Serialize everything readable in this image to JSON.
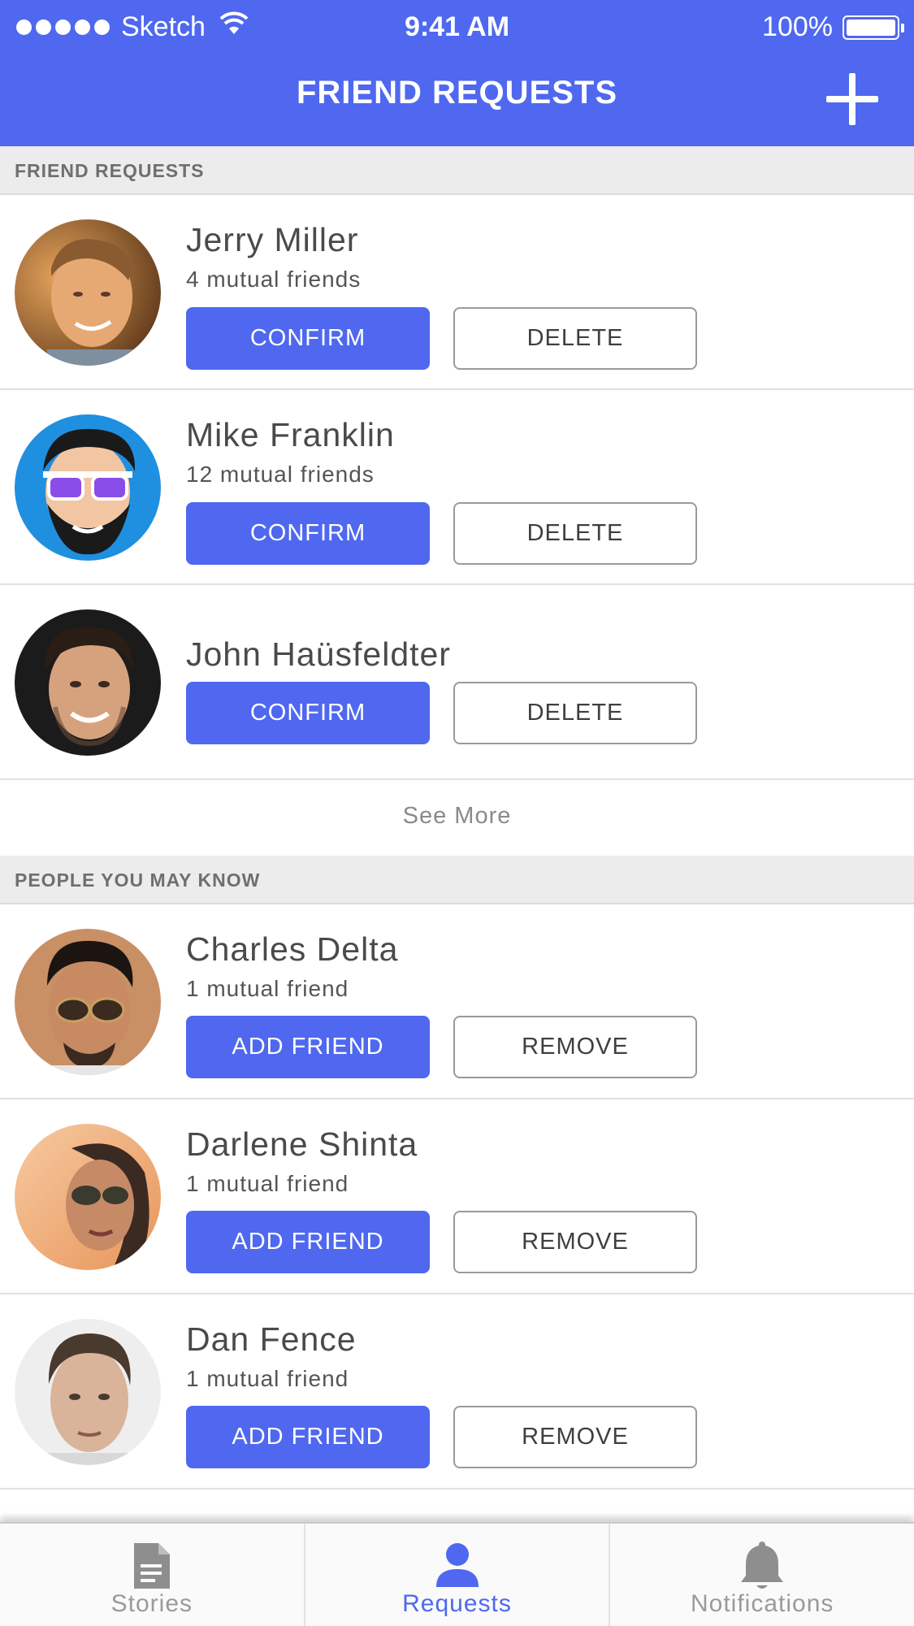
{
  "status_bar": {
    "carrier": "Sketch",
    "time": "9:41 AM",
    "battery": "100%"
  },
  "nav": {
    "title": "FRIEND REQUESTS"
  },
  "friend_requests": {
    "section_title": "FRIEND REQUESTS",
    "items": [
      {
        "name": "Jerry Miller",
        "mutual": "4 mutual friends",
        "confirm_label": "CONFIRM",
        "delete_label": "DELETE"
      },
      {
        "name": "Mike Franklin",
        "mutual": "12 mutual friends",
        "confirm_label": "CONFIRM",
        "delete_label": "DELETE"
      },
      {
        "name": "John Haüsfeldter",
        "mutual": "",
        "confirm_label": "CONFIRM",
        "delete_label": "DELETE"
      }
    ],
    "see_more": "See More"
  },
  "people_you_may_know": {
    "section_title": "PEOPLE YOU MAY KNOW",
    "items": [
      {
        "name": "Charles Delta",
        "mutual": "1 mutual friend",
        "add_label": "ADD FRIEND",
        "remove_label": "REMOVE"
      },
      {
        "name": "Darlene Shinta",
        "mutual": "1 mutual friend",
        "add_label": "ADD FRIEND",
        "remove_label": "REMOVE"
      },
      {
        "name": "Dan Fence",
        "mutual": "1 mutual friend",
        "add_label": "ADD FRIEND",
        "remove_label": "REMOVE"
      }
    ]
  },
  "tab_bar": {
    "tabs": [
      {
        "label": "Stories",
        "icon": "document-icon",
        "active": false
      },
      {
        "label": "Requests",
        "icon": "person-icon",
        "active": true
      },
      {
        "label": "Notifications",
        "icon": "bell-icon",
        "active": false
      }
    ]
  },
  "colors": {
    "accent": "#4f68ef",
    "section_background": "#ececec",
    "text": "#4a4a4a"
  }
}
